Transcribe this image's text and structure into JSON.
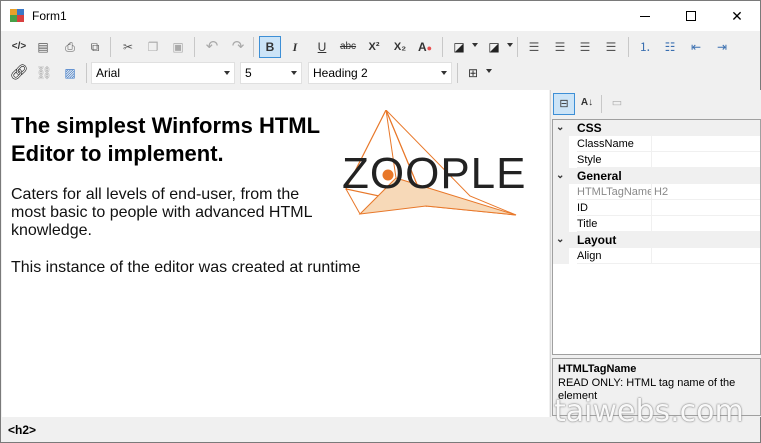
{
  "window": {
    "title": "Form1",
    "minimize": "—",
    "maximize": "☐",
    "close": "✕"
  },
  "toolbar1": {
    "buttons": [
      {
        "name": "view-source",
        "glyph": "</>"
      },
      {
        "name": "new-doc",
        "glyph": "▤"
      },
      {
        "name": "print",
        "glyph": "⎙"
      },
      {
        "name": "print-preview",
        "glyph": "🗎"
      },
      {
        "name": "cut",
        "glyph": "✂"
      },
      {
        "name": "copy",
        "glyph": "❐"
      },
      {
        "name": "paste",
        "glyph": "📋"
      },
      {
        "name": "undo",
        "glyph": "↶"
      },
      {
        "name": "redo",
        "glyph": "↷"
      },
      {
        "name": "bold",
        "glyph": "B"
      },
      {
        "name": "italic",
        "glyph": "I"
      },
      {
        "name": "underline",
        "glyph": "U"
      },
      {
        "name": "strikethrough",
        "glyph": "abc"
      },
      {
        "name": "superscript",
        "glyph": "X²"
      },
      {
        "name": "subscript",
        "glyph": "X₂"
      },
      {
        "name": "clear-format",
        "glyph": "A"
      },
      {
        "name": "forecolor",
        "glyph": "■"
      },
      {
        "name": "backcolor",
        "glyph": "■"
      },
      {
        "name": "align-left",
        "glyph": "≡"
      },
      {
        "name": "align-center",
        "glyph": "≡"
      },
      {
        "name": "align-right",
        "glyph": "≡"
      },
      {
        "name": "justify",
        "glyph": "≡"
      },
      {
        "name": "ordered-list",
        "glyph": "⒈"
      },
      {
        "name": "unordered-list",
        "glyph": "☰"
      },
      {
        "name": "outdent",
        "glyph": "⇤"
      },
      {
        "name": "indent",
        "glyph": "⇥"
      }
    ]
  },
  "toolbar2": {
    "font": "Arial",
    "size": "5",
    "style": "Heading 2"
  },
  "editor": {
    "heading": "The simplest Winforms HTML Editor to implement.",
    "para1": "Caters for all levels of end-user, from the most basic to people with advanced HTML knowledge.",
    "para2": "This instance of the editor was created at runtime",
    "logo_text": "ZOOPLE"
  },
  "propgrid": {
    "categories": [
      {
        "label": "CSS",
        "props": [
          {
            "name": "ClassName",
            "value": ""
          },
          {
            "name": "Style",
            "value": ""
          }
        ]
      },
      {
        "label": "General",
        "props": [
          {
            "name": "HTMLTagName",
            "value": "H2",
            "readonly": true
          },
          {
            "name": "ID",
            "value": ""
          },
          {
            "name": "Title",
            "value": ""
          }
        ]
      },
      {
        "label": "Layout",
        "props": [
          {
            "name": "Align",
            "value": ""
          }
        ]
      }
    ],
    "help_title": "HTMLTagName",
    "help_text": "READ ONLY: HTML tag name of the element"
  },
  "status": {
    "tag": "<h2>"
  },
  "watermark": "taiwebs.com",
  "colors": {
    "accent": "#3d8fd6",
    "logo_orange": "#e8782a",
    "logo_fill": "#f7d9b8"
  }
}
